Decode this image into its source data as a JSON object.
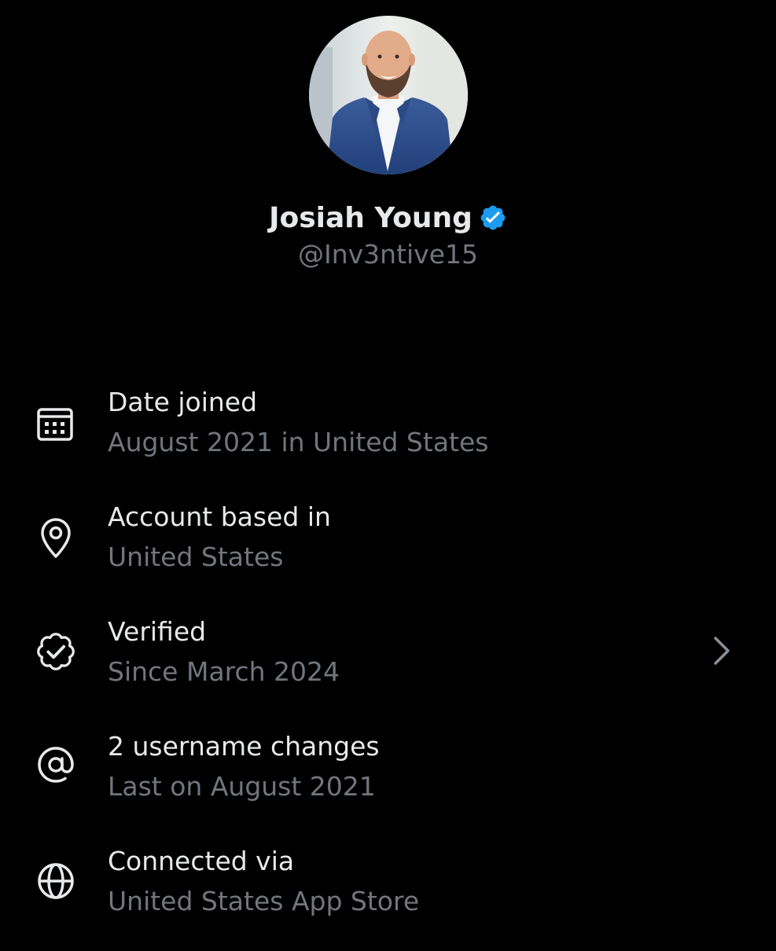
{
  "profile": {
    "display_name": "Josiah Young",
    "handle": "@Inv3ntive15",
    "verified_badge_icon": "verified-badge-icon",
    "badge_color": "#1d9bf0"
  },
  "details": [
    {
      "icon": "calendar-icon",
      "title": "Date joined",
      "value": "August 2021 in United States"
    },
    {
      "icon": "location-pin-icon",
      "title": "Account based in",
      "value": "United States"
    },
    {
      "icon": "verified-outline-icon",
      "title": "Verified",
      "value": "Since March 2024",
      "chevron_icon": "chevron-right-icon"
    },
    {
      "icon": "at-sign-icon",
      "title": "2 username changes",
      "value": "Last on August 2021"
    },
    {
      "icon": "globe-icon",
      "title": "Connected via",
      "value": "United States App Store"
    }
  ],
  "colors": {
    "background": "#000000",
    "primary_text": "#e7e9ea",
    "secondary_text": "#71767b",
    "accent": "#1d9bf0"
  }
}
